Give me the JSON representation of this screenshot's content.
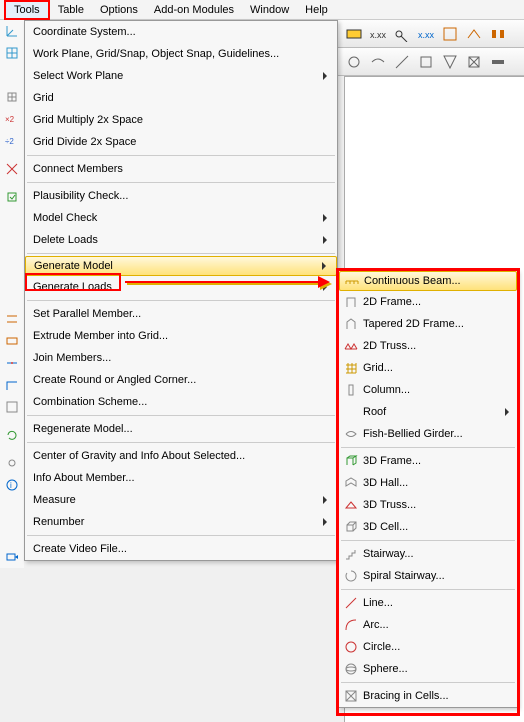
{
  "menubar": [
    "Tools",
    "Table",
    "Options",
    "Add-on Modules",
    "Window",
    "Help"
  ],
  "menubar_hotkeys": [
    "T",
    "T",
    "O",
    "A",
    "W",
    "H"
  ],
  "active_menu_index": 0,
  "dropdown": {
    "groups": [
      [
        "Coordinate System...",
        "Work Plane, Grid/Snap, Object Snap, Guidelines...",
        "Select Work Plane ▶",
        "Grid",
        "Grid Multiply 2x Space",
        "Grid Divide 2x Space"
      ],
      [
        "Connect Members"
      ],
      [
        "Plausibility Check...",
        "Model Check ▶",
        "Delete Loads ▶"
      ],
      [
        "Generate Model ▶",
        "Generate Loads ▶"
      ],
      [
        "Set Parallel Member...",
        "Extrude Member into Grid...",
        "Join Members...",
        "Create Round or Angled Corner...",
        "Combination Scheme..."
      ],
      [
        "Regenerate Model..."
      ],
      [
        "Center of Gravity and Info About Selected...",
        "Info About Member...",
        "Measure ▶",
        "Renumber ▶"
      ],
      [
        "Create Video File..."
      ]
    ],
    "highlight": "Generate Model"
  },
  "left_icons": [
    "coord-sys-icon",
    "workplane-icon",
    "select-workplane-icon",
    "grid-icon",
    "grid-up-icon",
    "grid-down-icon",
    "connect-icon",
    "plausibility-icon",
    "model-check-icon",
    "delete-loads-icon",
    "generate-model-icon",
    "generate-loads-icon",
    "parallel-icon",
    "extrude-icon",
    "join-icon",
    "corner-icon",
    "combination-icon",
    "regenerate-icon",
    "cog-icon",
    "info-icon",
    "measure-icon",
    "renumber-icon",
    "video-icon"
  ],
  "submenu": {
    "groups": [
      [
        "Continuous Beam...",
        "2D Frame...",
        "Tapered 2D Frame...",
        "2D Truss...",
        "Grid...",
        "Column...",
        "Roof ▶",
        "Fish-Bellied Girder..."
      ],
      [
        "3D Frame...",
        "3D Hall...",
        "3D Truss...",
        "3D Cell..."
      ],
      [
        "Stairway...",
        "Spiral Stairway..."
      ],
      [
        "Line...",
        "Arc...",
        "Circle...",
        "Sphere..."
      ],
      [
        "Bracing in Cells..."
      ]
    ],
    "highlight": "Continuous Beam..."
  },
  "submenu_icons": [
    "beam-icon",
    "frame2d-icon",
    "tapered-icon",
    "truss2d-icon",
    "grid3d-icon",
    "column-icon",
    "roof-icon",
    "fish-icon",
    "frame3d-icon",
    "hall3d-icon",
    "truss3d-icon",
    "cell3d-icon",
    "stair-icon",
    "spiral-icon",
    "line-icon",
    "arc-icon",
    "circle-icon",
    "sphere-icon",
    "bracing-icon"
  ],
  "toolbar_row1": [
    "tool-a",
    "tool-b",
    "tool-c",
    "tool-d",
    "tool-e",
    "tool-f",
    "tool-g"
  ],
  "toolbar_row2": [
    "tool-h",
    "tool-i",
    "tool-j",
    "tool-k",
    "tool-l",
    "tool-m",
    "tool-n"
  ]
}
